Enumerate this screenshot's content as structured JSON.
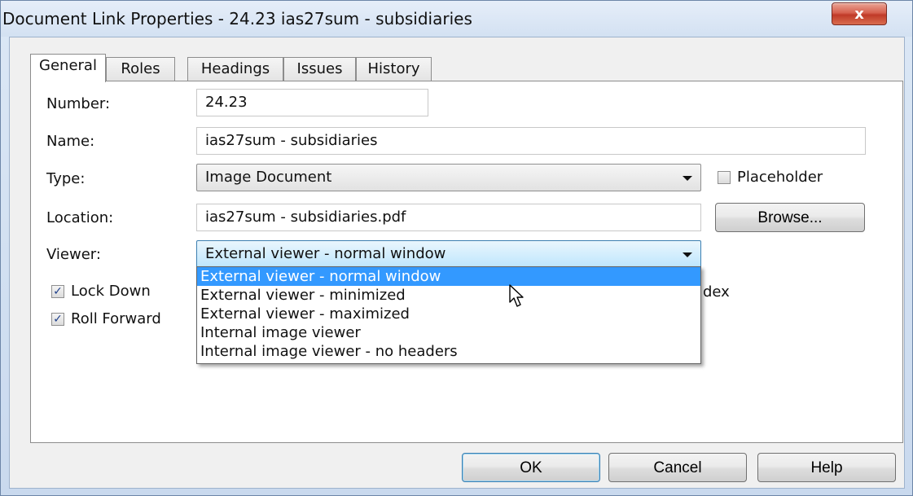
{
  "window": {
    "title": "Document Link Properties - 24.23 ias27sum - subsidiaries",
    "close_label": "x"
  },
  "tabs": [
    {
      "label": "General",
      "active": true
    },
    {
      "label": "Roles",
      "active": false
    },
    {
      "label": "Headings",
      "active": false
    },
    {
      "label": "Issues",
      "active": false
    },
    {
      "label": "History",
      "active": false
    }
  ],
  "form": {
    "number_label": "Number:",
    "number_value": "24.23",
    "name_label": "Name:",
    "name_value": "ias27sum - subsidiaries",
    "type_label": "Type:",
    "type_value": "Image Document",
    "placeholder_label": "Placeholder",
    "placeholder_checked": false,
    "location_label": "Location:",
    "location_value": "ias27sum - subsidiaries.pdf",
    "browse_label": "Browse...",
    "viewer_label": "Viewer:",
    "viewer_value": "External viewer - normal window",
    "lock_down_label": "Lock Down",
    "lock_down_checked": true,
    "roll_forward_label": "Roll Forward",
    "roll_forward_checked": true,
    "partial_hidden_text": "dex"
  },
  "viewer_options": [
    "External viewer - normal window",
    "External viewer - minimized",
    "External viewer - maximized",
    "Internal image viewer",
    "Internal image viewer - no headers"
  ],
  "buttons": {
    "ok": "OK",
    "cancel": "Cancel",
    "help": "Help"
  }
}
